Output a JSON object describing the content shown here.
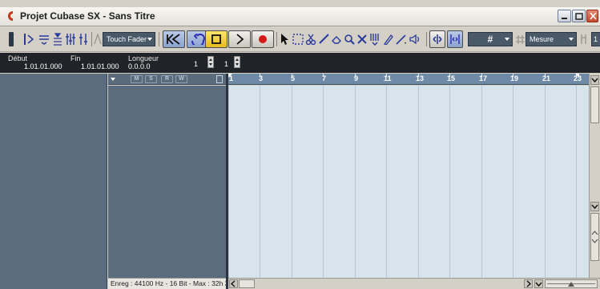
{
  "window": {
    "title": "Projet Cubase SX - Sans Titre"
  },
  "toolbar": {
    "automation_mode": "Touch Fader",
    "snap_value": "#",
    "quantize_mode": "Mesure",
    "quantize_value": "1"
  },
  "info": {
    "start_label": "Début",
    "start_value": "1.01.01.000",
    "end_label": "Fin",
    "end_value": "1.01.01.000",
    "length_label": "Longueur",
    "length_value": "0.0.0.0",
    "field_a": "1",
    "field_b": "1"
  },
  "tracklist": {
    "buttons": [
      "M",
      "S",
      "R",
      "W"
    ]
  },
  "ruler": {
    "marks": [
      "1",
      "3",
      "5",
      "7",
      "9",
      "11",
      "13",
      "15",
      "17",
      "19",
      "21",
      "23"
    ]
  },
  "status": {
    "text": "Enreg : 44100 Hz - 16 Bit - Max : 32h 3"
  },
  "colors": {
    "title_accent": "#c0391d",
    "inspector_bg": "#5b6c7f",
    "event_bg": "#d8e4ec",
    "ruler_bg": "#6e8aa6",
    "record_red": "#d11a1a",
    "play_button": "#f0c630"
  }
}
